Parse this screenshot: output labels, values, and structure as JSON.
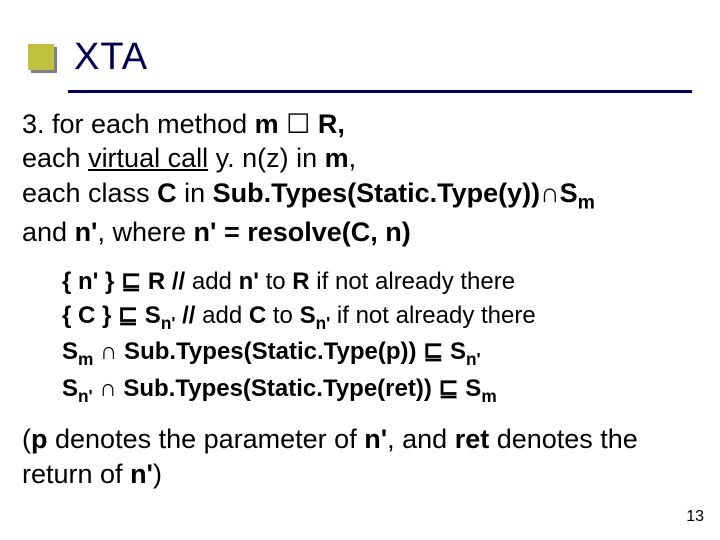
{
  "title": "XTA",
  "rule": {
    "line1_a": "3. for each method ",
    "line1_b": "m",
    "line1_c": " R,",
    "line2_a": "each ",
    "line2_b": "virtual call",
    "line2_c": " y. n(z) in ",
    "line2_d": "m",
    "line2_e": ",",
    "line3_a": "each class ",
    "line3_b": "C",
    "line3_c": " in ",
    "line3_d": "Sub.Types(Static.Type(y))",
    "line3_sub": "m",
    "line3_e": "S",
    "line4_a": "and ",
    "line4_b": "n'",
    "line4_c": ", where ",
    "line4_d": "n' = resolve(C, n)"
  },
  "constraints": {
    "c1_a": "{ n' } ",
    "c1_b": " R  // ",
    "c1_c": "add ",
    "c1_d": "n'",
    "c1_e": " to ",
    "c1_f": "R",
    "c1_g": " if not already there",
    "c2_a": "{ C } ",
    "c2_b": " S",
    "c2_sub": "n'",
    "c2_c": " // ",
    "c2_d": "add ",
    "c2_e": "C",
    "c2_f": " to ",
    "c2_g": "S",
    "c2_h": " if not already there",
    "c3_a": "S",
    "c3_sub1": "m",
    "c3_b": " Sub.Types(Static.Type(p)) ",
    "c3_c": " S",
    "c3_sub2": "n'",
    "c4_a": "S",
    "c4_sub1": "n'",
    "c4_b": " Sub.Types(Static.Type(ret)) ",
    "c4_c": " S",
    "c4_sub2": "m"
  },
  "foot": {
    "a": "(",
    "b": "p",
    "c": " denotes the parameter of ",
    "d": "n'",
    "e": ", and ",
    "f": "ret",
    "g": " denotes the return of ",
    "h": "n'",
    "i": ")"
  },
  "symbols": {
    "in_square": "☐",
    "cap": "∩",
    "sqsubeq": "⊑"
  },
  "page_num": "13"
}
